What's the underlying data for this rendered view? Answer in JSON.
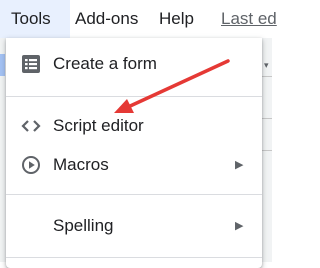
{
  "menubar": {
    "tools": "Tools",
    "addons": "Add-ons",
    "help": "Help",
    "last_edit": "Last ed"
  },
  "menu": {
    "items": [
      {
        "label": "Create a form",
        "icon": "form-list-icon"
      },
      {
        "label": "Script editor",
        "icon": "code-brackets-icon"
      },
      {
        "label": "Macros",
        "icon": "play-circle-icon",
        "has_submenu": true
      },
      {
        "label": "Spelling",
        "has_submenu": true
      }
    ]
  },
  "colors": {
    "active_menu_bg": "#e8f0fe",
    "annotation_arrow": "#e53935"
  }
}
